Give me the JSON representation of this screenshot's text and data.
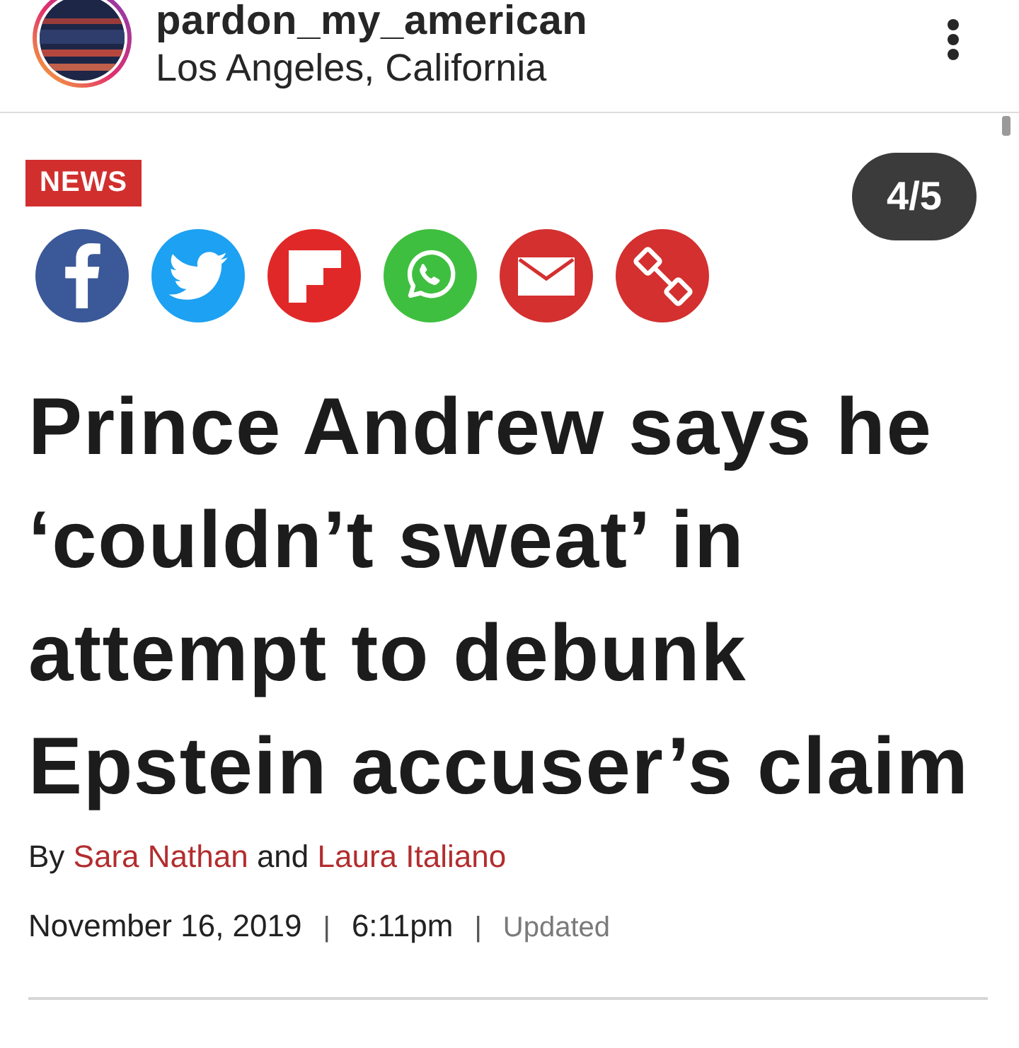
{
  "header": {
    "username": "pardon_my_american",
    "location": "Los Angeles, California"
  },
  "article": {
    "category": "NEWS",
    "counter": "4/5",
    "share_buttons": [
      {
        "kind": "facebook"
      },
      {
        "kind": "twitter"
      },
      {
        "kind": "flipboard"
      },
      {
        "kind": "whatsapp"
      },
      {
        "kind": "email"
      },
      {
        "kind": "link"
      }
    ],
    "headline": "Prince Andrew says he ‘couldn’t sweat’ in attempt to debunk Epstein accuser’s claim",
    "byline": {
      "lead": "By",
      "authors": [
        "Sara Nathan",
        "Laura Italiano"
      ],
      "joiner": "and"
    },
    "meta": [
      {
        "kind": "date",
        "text": "November 16, 2019"
      },
      {
        "kind": "separator",
        "text": "|"
      },
      {
        "kind": "time",
        "text": "6:11pm"
      },
      {
        "kind": "separator",
        "text": "|"
      },
      {
        "kind": "status",
        "text": "Updated"
      }
    ]
  }
}
